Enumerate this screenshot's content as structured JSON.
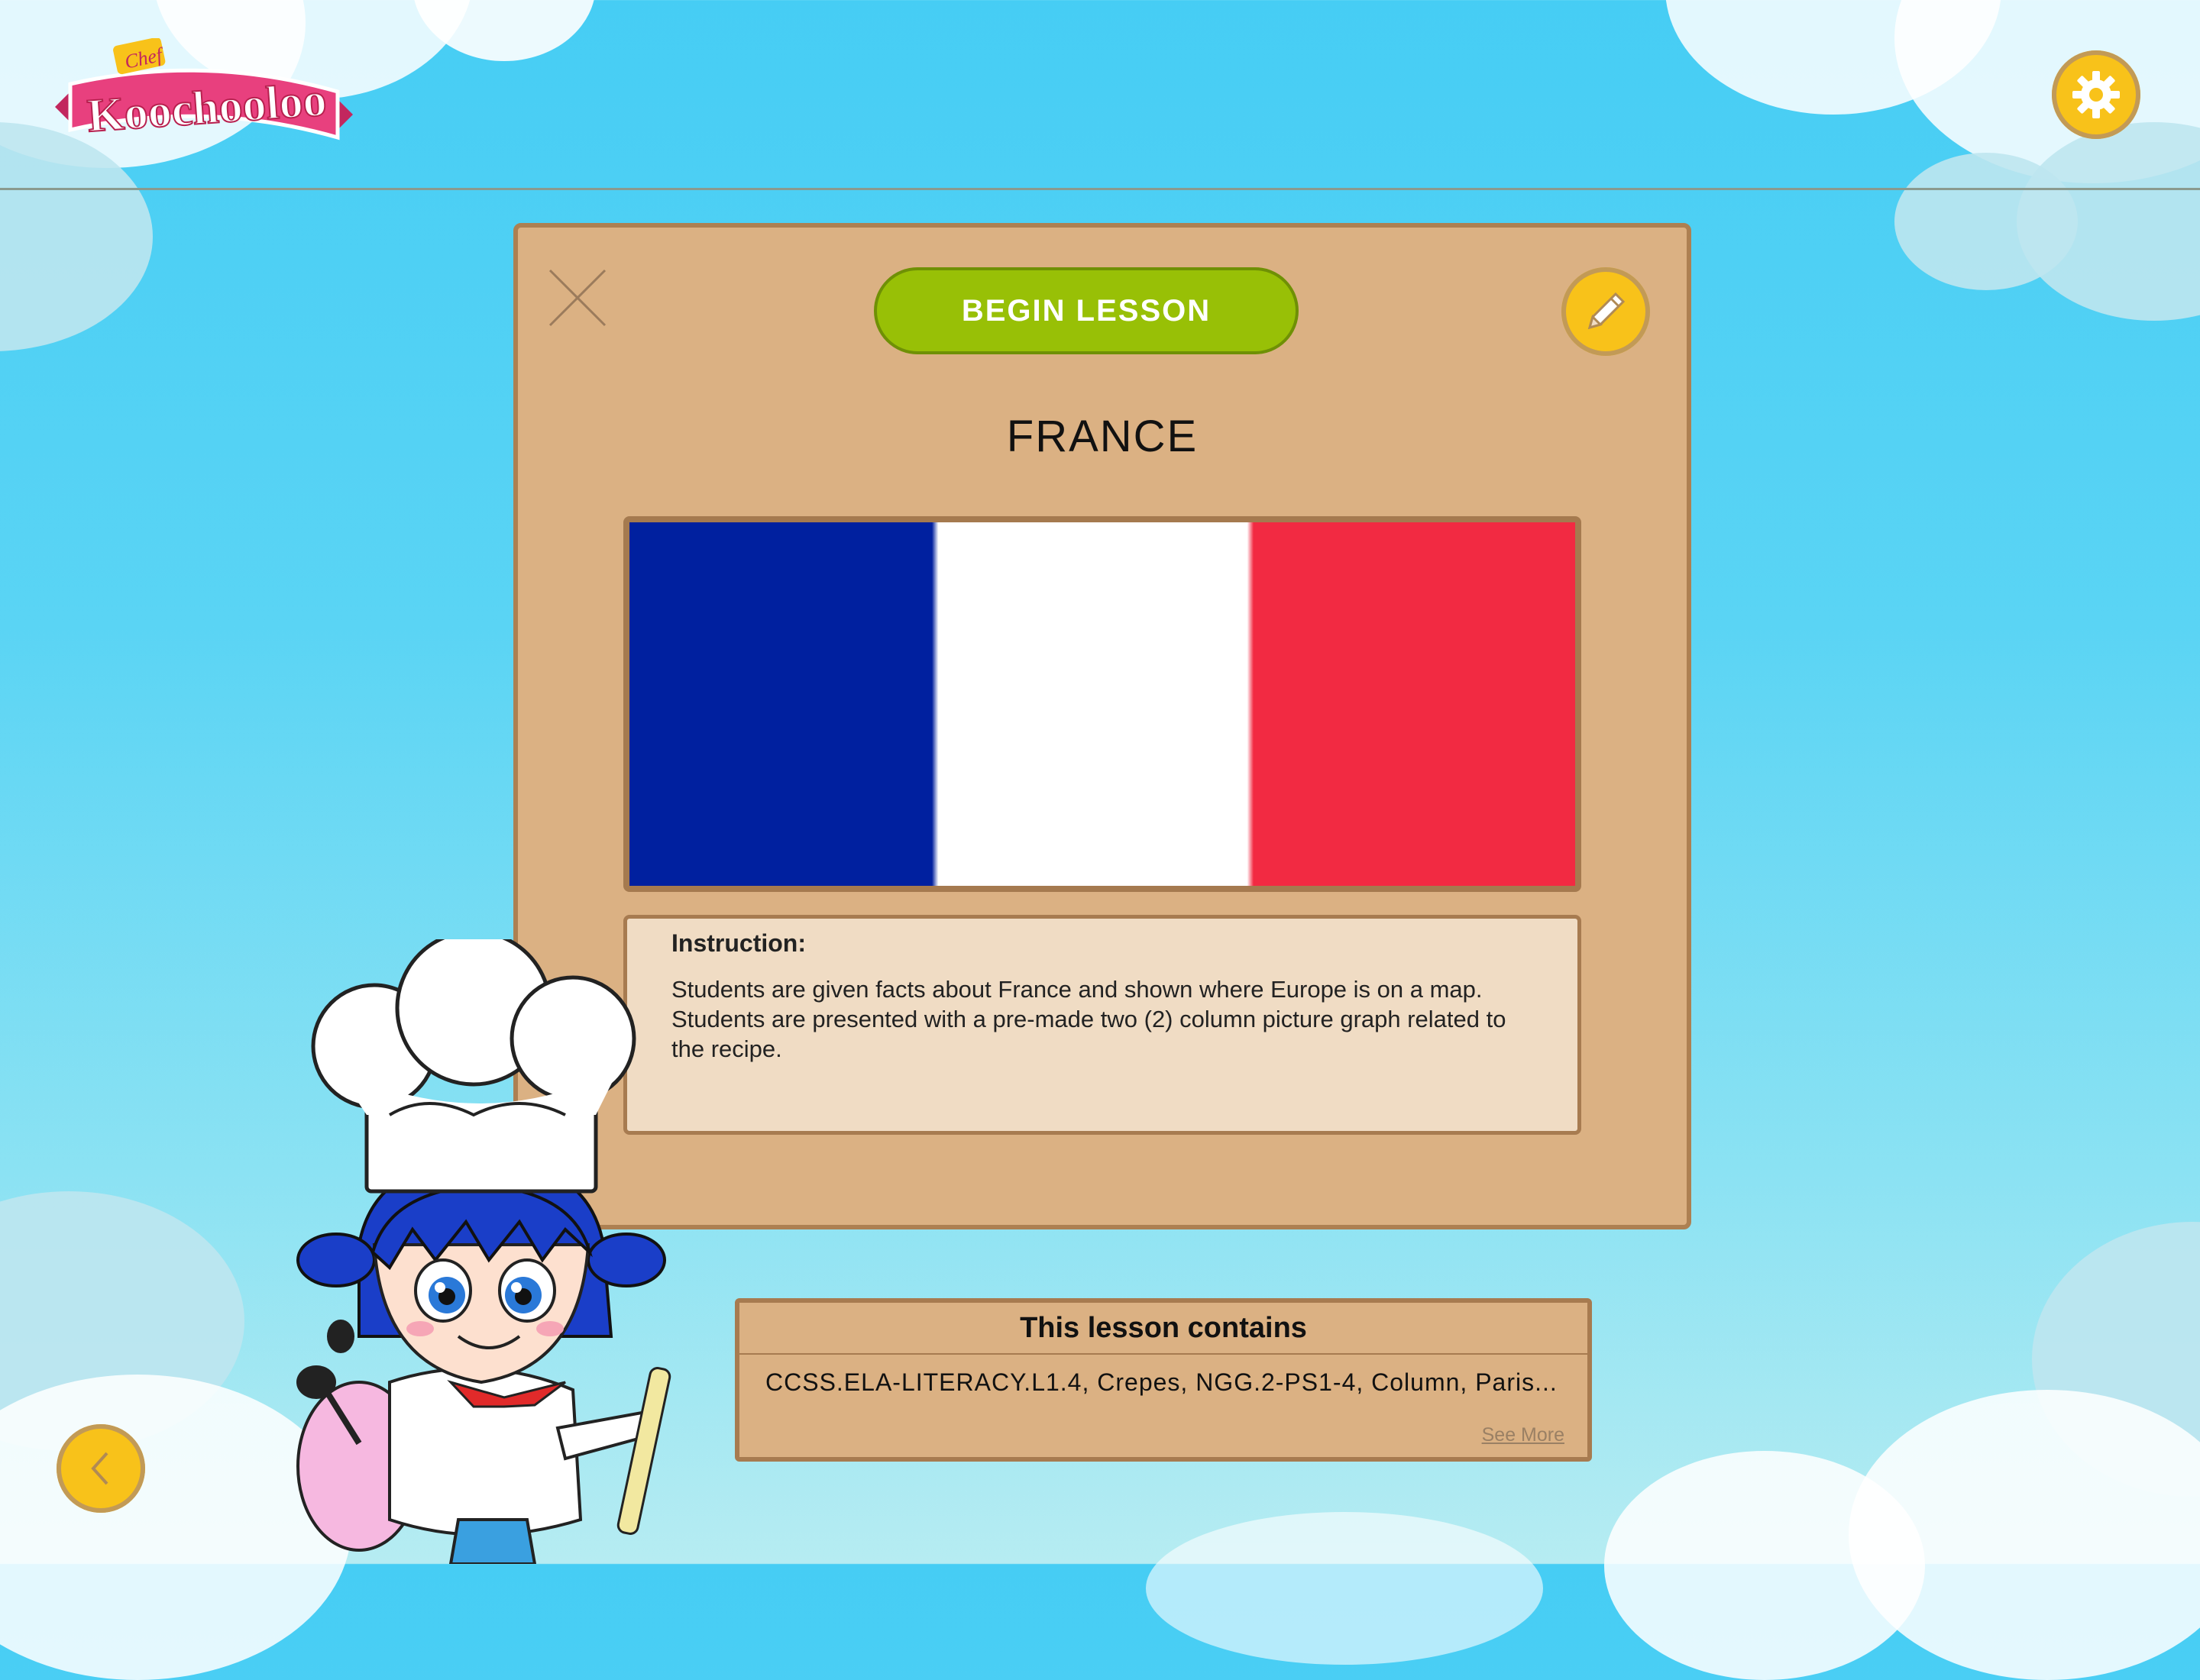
{
  "app": {
    "logo_text_small": "Chef",
    "logo_text": "Koochooloo"
  },
  "toolbar": {
    "settings_icon": "gear-icon",
    "back_icon": "chevron-left-icon"
  },
  "lesson_card": {
    "begin_label": "BEGIN LESSON",
    "close_icon": "close-icon",
    "edit_icon": "pencil-icon",
    "title": "FRANCE",
    "flag": {
      "colors": [
        "#00209f",
        "#ffffff",
        "#f22a42"
      ]
    },
    "instruction_label": "Instruction:",
    "instruction_text": "Students are given facts about France and shown where Europe is on a map. Students are presented with a pre-made two (2) column picture graph related to the recipe."
  },
  "lesson_contains": {
    "title": "This lesson contains",
    "items_text": "CCSS.ELA-LITERACY.L1.4, Crepes, NGG.2-PS1-4, Column, Paris...",
    "see_more": "See More"
  },
  "colors": {
    "card_bg": "#dbb183",
    "card_border": "#ad8052",
    "accent_yellow": "#f8c21a",
    "begin_green": "#98c006",
    "logo_pink": "#e8407e"
  }
}
